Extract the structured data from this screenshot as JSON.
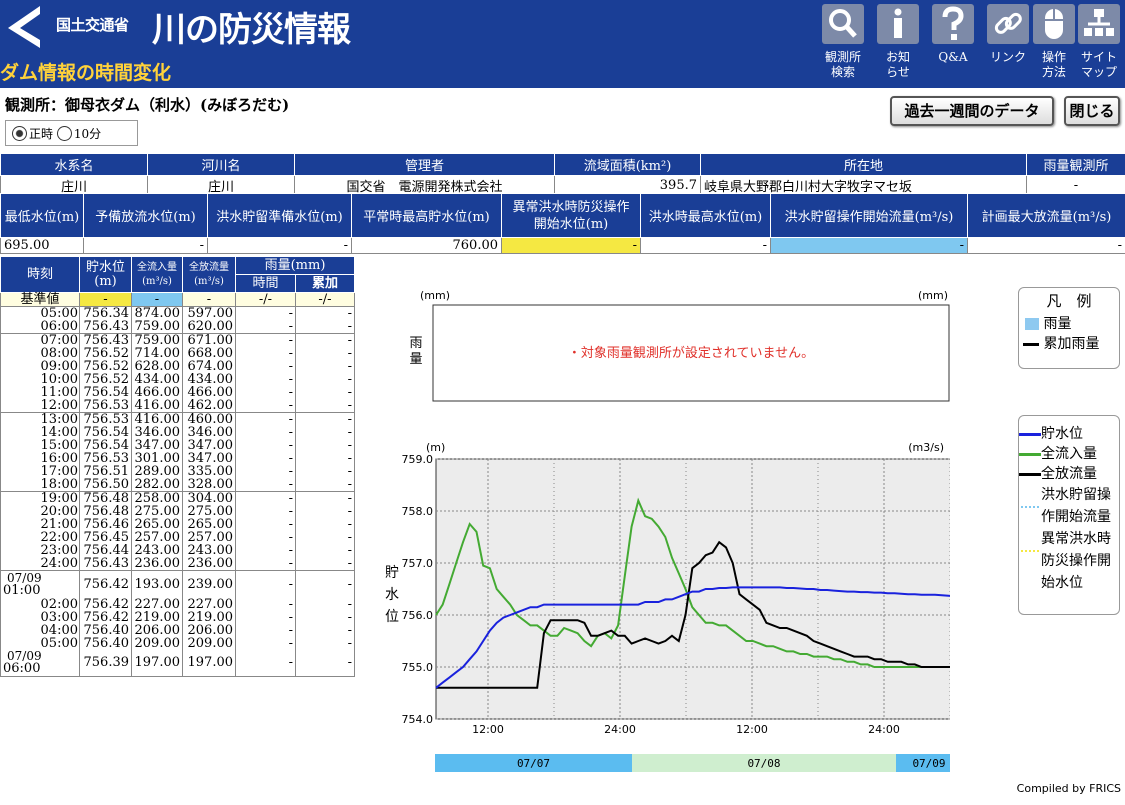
{
  "header": {
    "ministry": "国土交通省",
    "site_title": "川の防災情報",
    "page_subtitle": "ダム情報の時間変化",
    "nav": [
      {
        "label": "観測所\n検索",
        "icon": "search-icon"
      },
      {
        "label": "お知\nらせ",
        "icon": "info-icon"
      },
      {
        "label": "Q&A",
        "icon": "question-icon"
      },
      {
        "label": "リンク",
        "icon": "link-icon"
      },
      {
        "label": "操作\n方法",
        "icon": "mouse-icon"
      },
      {
        "label": "サイト\nマップ",
        "icon": "sitemap-icon"
      }
    ]
  },
  "station": {
    "title": "観測所：御母衣ダム（利水）(みぼろだむ)",
    "btn_week": "過去一週間のデータ",
    "btn_close": "閉じる",
    "radio_hourly": "正時",
    "radio_10min": "10分",
    "selected": "正時"
  },
  "info1": {
    "headers": [
      "水系名",
      "河川名",
      "管理者",
      "流域面積(km²)",
      "所在地",
      "雨量観測所"
    ],
    "values": [
      "庄川",
      "庄川",
      "国交省　電源開発株式会社",
      "395.7",
      "岐阜県大野郡白川村大字牧字マセ坂",
      "-"
    ]
  },
  "info2": {
    "headers": [
      "最低水位(m)",
      "予備放流水位(m)",
      "洪水貯留準備水位(m)",
      "平常時最高貯水位(m)",
      "異常洪水時防災操作\n開始水位(m)",
      "洪水時最高水位(m)",
      "洪水貯留操作開始流量(m³/s)",
      "計画最大放流量(m³/s)"
    ],
    "values": [
      "695.00",
      "-",
      "-",
      "760.00",
      "-",
      "-",
      "-",
      "-"
    ]
  },
  "table": {
    "headers": {
      "time": "時刻",
      "level": "貯水位\n(m)",
      "inflow": "全流入量\n(m³/s)",
      "outflow": "全放流量\n(m³/s)",
      "rain": "雨量(mm)",
      "rain_hour": "時間",
      "rain_cum": "累加"
    },
    "reference": {
      "label": "基準値",
      "level": "-",
      "inflow": "-",
      "outflow": "-",
      "rain_hour": "-/-",
      "rain_cum": "-/-"
    },
    "rows": [
      [
        "05:00",
        "756.34",
        "874.00",
        "597.00",
        "-",
        "-"
      ],
      [
        "06:00",
        "756.43",
        "759.00",
        "620.00",
        "-",
        "-"
      ],
      [
        "07:00",
        "756.43",
        "759.00",
        "671.00",
        "-",
        "-"
      ],
      [
        "08:00",
        "756.52",
        "714.00",
        "668.00",
        "-",
        "-"
      ],
      [
        "09:00",
        "756.52",
        "628.00",
        "674.00",
        "-",
        "-"
      ],
      [
        "10:00",
        "756.52",
        "434.00",
        "434.00",
        "-",
        "-"
      ],
      [
        "11:00",
        "756.54",
        "466.00",
        "466.00",
        "-",
        "-"
      ],
      [
        "12:00",
        "756.53",
        "416.00",
        "462.00",
        "-",
        "-"
      ],
      [
        "13:00",
        "756.53",
        "416.00",
        "460.00",
        "-",
        "-"
      ],
      [
        "14:00",
        "756.54",
        "346.00",
        "346.00",
        "-",
        "-"
      ],
      [
        "15:00",
        "756.54",
        "347.00",
        "347.00",
        "-",
        "-"
      ],
      [
        "16:00",
        "756.53",
        "301.00",
        "347.00",
        "-",
        "-"
      ],
      [
        "17:00",
        "756.51",
        "289.00",
        "335.00",
        "-",
        "-"
      ],
      [
        "18:00",
        "756.50",
        "282.00",
        "328.00",
        "-",
        "-"
      ],
      [
        "19:00",
        "756.48",
        "258.00",
        "304.00",
        "-",
        "-"
      ],
      [
        "20:00",
        "756.48",
        "275.00",
        "275.00",
        "-",
        "-"
      ],
      [
        "21:00",
        "756.46",
        "265.00",
        "265.00",
        "-",
        "-"
      ],
      [
        "22:00",
        "756.45",
        "257.00",
        "257.00",
        "-",
        "-"
      ],
      [
        "23:00",
        "756.44",
        "243.00",
        "243.00",
        "-",
        "-"
      ],
      [
        "24:00",
        "756.43",
        "236.00",
        "236.00",
        "-",
        "-"
      ],
      [
        "07/09 01:00",
        "756.42",
        "193.00",
        "239.00",
        "-",
        "-"
      ],
      [
        "02:00",
        "756.42",
        "227.00",
        "227.00",
        "-",
        "-"
      ],
      [
        "03:00",
        "756.42",
        "219.00",
        "219.00",
        "-",
        "-"
      ],
      [
        "04:00",
        "756.40",
        "206.00",
        "206.00",
        "-",
        "-"
      ],
      [
        "05:00",
        "756.40",
        "209.00",
        "209.00",
        "-",
        "-"
      ],
      [
        "07/09 06:00",
        "756.39",
        "197.00",
        "197.00",
        "-",
        "-"
      ]
    ]
  },
  "chart_data": [
    {
      "type": "bar",
      "left_unit": "(mm)",
      "right_unit": "(mm)",
      "ylabel": "雨量",
      "y2label": "累加雨量",
      "message": "・対象雨量観測所が設定されていません。",
      "legend_title": "凡　例",
      "legend": [
        {
          "name": "雨量",
          "color": "#8ec9f0"
        },
        {
          "name": "累加雨量",
          "color": "#000000"
        }
      ]
    },
    {
      "type": "line",
      "left_unit": "(m)",
      "right_unit": "(m3/s)",
      "ylabel": "貯水位",
      "y2label": "全流入量／全放流量",
      "ylim": [
        754.0,
        759.0
      ],
      "y2lim": [
        0,
        1000
      ],
      "yticks": [
        "754.0",
        "755.0",
        "756.0",
        "757.0",
        "758.0",
        "759.0"
      ],
      "y2ticks": [
        "0",
        "200",
        "400",
        "600",
        "800",
        "1000"
      ],
      "xticks": [
        "12:00",
        "24:00",
        "12:00",
        "24:00"
      ],
      "date_bands": [
        {
          "label": "07/07",
          "color": "#5bbcf0"
        },
        {
          "label": "07/08",
          "color": "#cfeecf"
        },
        {
          "label": "07/09",
          "color": "#5bbcf0"
        }
      ],
      "legend": [
        {
          "name": "貯水位",
          "color": "#1a22dd"
        },
        {
          "name": "全流入量",
          "color": "#44aa33"
        },
        {
          "name": "全放流量",
          "color": "#000000"
        },
        {
          "name": "洪水貯留操作開始流量",
          "color": "#7fc8f0"
        },
        {
          "name": "異常洪水時防災操作開始水位",
          "color": "#f5e842"
        }
      ],
      "series": [
        {
          "name": "貯水位",
          "values": [
            754.6,
            754.7,
            754.8,
            754.9,
            755.0,
            755.15,
            755.3,
            755.5,
            755.7,
            755.85,
            755.95,
            756.0,
            756.05,
            756.1,
            756.15,
            756.15,
            756.2,
            756.2,
            756.2,
            756.2,
            756.2,
            756.2,
            756.2,
            756.2,
            756.2,
            756.2,
            756.2,
            756.2,
            756.2,
            756.2,
            756.2,
            756.25,
            756.25,
            756.25,
            756.3,
            756.3,
            756.35,
            756.4,
            756.45,
            756.45,
            756.5,
            756.5,
            756.52,
            756.52,
            756.53,
            756.53,
            756.53,
            756.53,
            756.53,
            756.53,
            756.53,
            756.53,
            756.52,
            756.52,
            756.51,
            756.5,
            756.5,
            756.48,
            756.48,
            756.47,
            756.46,
            756.45,
            756.45,
            756.44,
            756.44,
            756.43,
            756.43,
            756.42,
            756.42,
            756.41,
            756.4,
            756.4,
            756.39,
            756.39,
            756.39,
            756.38,
            756.37,
            756.36,
            756.35
          ]
        },
        {
          "name": "全流入量",
          "values": [
            400,
            440,
            520,
            600,
            680,
            750,
            720,
            590,
            580,
            500,
            470,
            440,
            400,
            380,
            360,
            360,
            340,
            320,
            320,
            350,
            340,
            330,
            300,
            280,
            320,
            330,
            310,
            360,
            550,
            740,
            840,
            780,
            770,
            740,
            700,
            620,
            560,
            500,
            430,
            400,
            370,
            370,
            360,
            360,
            340,
            320,
            300,
            300,
            290,
            280,
            280,
            270,
            260,
            260,
            250,
            250,
            240,
            240,
            240,
            230,
            230,
            220,
            220,
            210,
            210,
            200,
            200,
            200,
            200,
            200,
            200,
            200,
            200,
            200,
            200,
            200,
            200,
            200,
            200
          ]
        },
        {
          "name": "全放流量",
          "values": [
            120,
            120,
            120,
            120,
            120,
            120,
            120,
            120,
            120,
            120,
            120,
            120,
            120,
            120,
            120,
            120,
            330,
            380,
            380,
            380,
            380,
            380,
            370,
            320,
            320,
            330,
            340,
            320,
            320,
            290,
            300,
            310,
            300,
            290,
            300,
            320,
            300,
            400,
            580,
            600,
            630,
            640,
            680,
            660,
            600,
            480,
            460,
            440,
            420,
            370,
            360,
            350,
            350,
            340,
            330,
            320,
            300,
            290,
            280,
            270,
            260,
            250,
            240,
            240,
            240,
            230,
            230,
            220,
            220,
            220,
            210,
            210,
            200,
            200,
            200,
            200,
            200,
            200,
            200
          ]
        }
      ]
    }
  ],
  "footer": {
    "compiled": "Compiled by FRICS"
  }
}
